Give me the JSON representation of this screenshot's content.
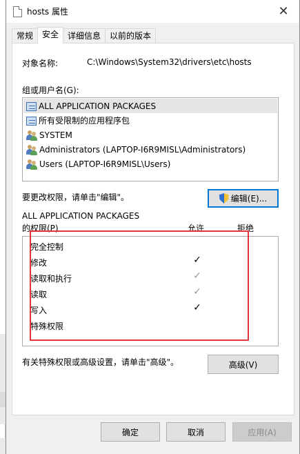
{
  "window": {
    "title": "hosts 属性",
    "close_glyph": "✕"
  },
  "tabs": [
    {
      "label": "常规",
      "active": false
    },
    {
      "label": "安全",
      "active": true
    },
    {
      "label": "详细信息",
      "active": false
    },
    {
      "label": "以前的版本",
      "active": false
    }
  ],
  "object": {
    "label": "对象名称:",
    "value": "C:\\Windows\\System32\\drivers\\etc\\hosts"
  },
  "groups": {
    "label": "组或用户名(G):",
    "items": [
      {
        "label": "ALL APPLICATION PACKAGES",
        "icon": "package-icon",
        "selected": true
      },
      {
        "label": "所有受限制的应用程序包",
        "icon": "package-icon",
        "selected": false
      },
      {
        "label": "SYSTEM",
        "icon": "users-icon",
        "selected": false
      },
      {
        "label": "Administrators (LAPTOP-I6R9MISL\\Administrators)",
        "icon": "users-icon",
        "selected": false
      },
      {
        "label": "Users (LAPTOP-I6R9MISL\\Users)",
        "icon": "users-icon",
        "selected": false
      }
    ]
  },
  "edit": {
    "hint": "要更改权限，请单击\"编辑\"。",
    "button": "编辑(E)..."
  },
  "permissions": {
    "principal": "ALL APPLICATION PACKAGES",
    "header_label": "的权限(P)",
    "allow_header": "允许",
    "deny_header": "拒绝",
    "check_glyph": "✓",
    "rows": [
      {
        "label": "完全控制",
        "allow": "none"
      },
      {
        "label": "修改",
        "allow": "checked"
      },
      {
        "label": "读取和执行",
        "allow": "inherited"
      },
      {
        "label": "读取",
        "allow": "inherited"
      },
      {
        "label": "写入",
        "allow": "checked"
      },
      {
        "label": "特殊权限",
        "allow": "none"
      }
    ]
  },
  "advanced": {
    "hint": "有关特殊权限或高级设置，请单击\"高级\"。",
    "button": "高级(V)"
  },
  "footer": {
    "ok": "确定",
    "cancel": "取消",
    "apply": "应用(A)"
  },
  "colors": {
    "highlight_frame": "#e0333a",
    "focus_border": "#0078d7"
  }
}
